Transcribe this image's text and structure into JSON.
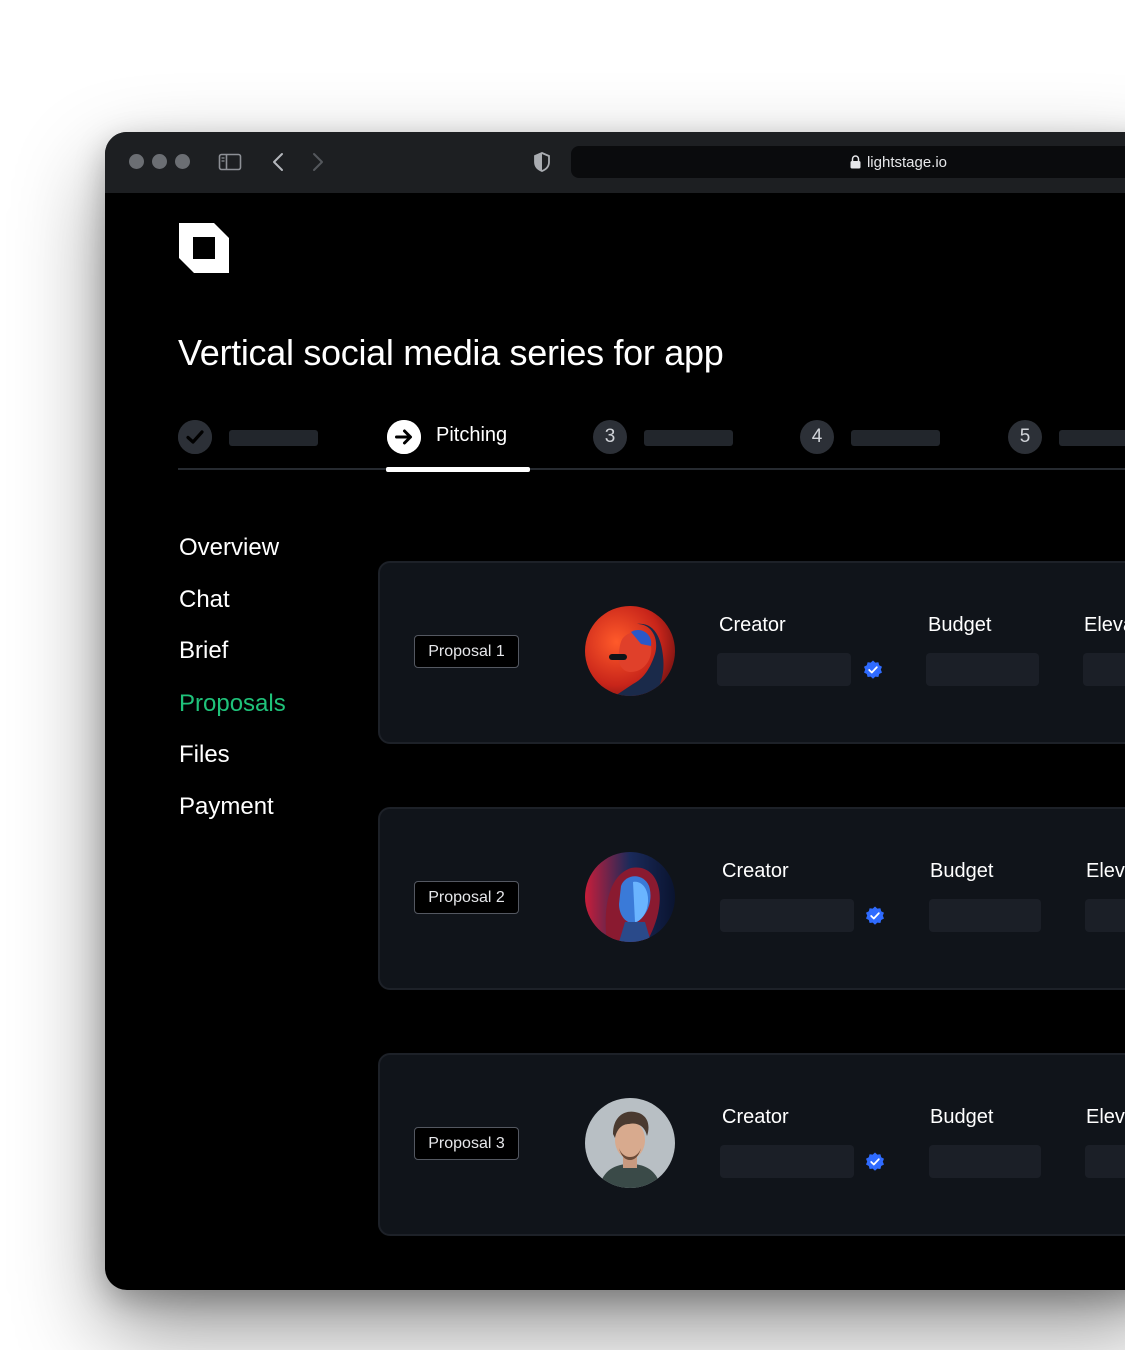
{
  "browser": {
    "url": "lightstage.io",
    "icons": [
      "window-dot",
      "sidebar-toggle-icon",
      "back-arrow-icon",
      "forward-arrow-icon",
      "shield-icon",
      "lock-icon"
    ]
  },
  "app": {
    "logo": "lightstage-logo",
    "title": "Vertical social media series for app"
  },
  "stepper": {
    "steps": [
      {
        "marker": "check-icon",
        "label": "",
        "state": "done"
      },
      {
        "marker": "arrow-right-icon",
        "label": "Pitching",
        "state": "active"
      },
      {
        "marker": "3",
        "label": "",
        "state": "upcoming"
      },
      {
        "marker": "4",
        "label": "",
        "state": "upcoming"
      },
      {
        "marker": "5",
        "label": "",
        "state": "upcoming"
      }
    ]
  },
  "nav": {
    "items": [
      {
        "label": "Overview"
      },
      {
        "label": "Chat"
      },
      {
        "label": "Brief"
      },
      {
        "label": "Proposals",
        "active": true
      },
      {
        "label": "Files"
      },
      {
        "label": "Payment"
      }
    ],
    "active_color": "#1fc27a"
  },
  "proposals": [
    {
      "badge": "Proposal 1",
      "creator_label": "Creator",
      "budget_label": "Budget",
      "third_label": "Eleva",
      "avatar": "avatar-red-helmet"
    },
    {
      "badge": "Proposal 2",
      "creator_label": "Creator",
      "budget_label": "Budget",
      "third_label": "Eleva",
      "avatar": "avatar-neon-woman"
    },
    {
      "badge": "Proposal 3",
      "creator_label": "Creator",
      "budget_label": "Budget",
      "third_label": "Eleva",
      "avatar": "avatar-man-portrait"
    }
  ],
  "colors": {
    "window_bg": "#000000",
    "titlebar_bg": "#1d1f22",
    "card_bg": "#10141a",
    "verified_blue": "#2f6bff"
  }
}
